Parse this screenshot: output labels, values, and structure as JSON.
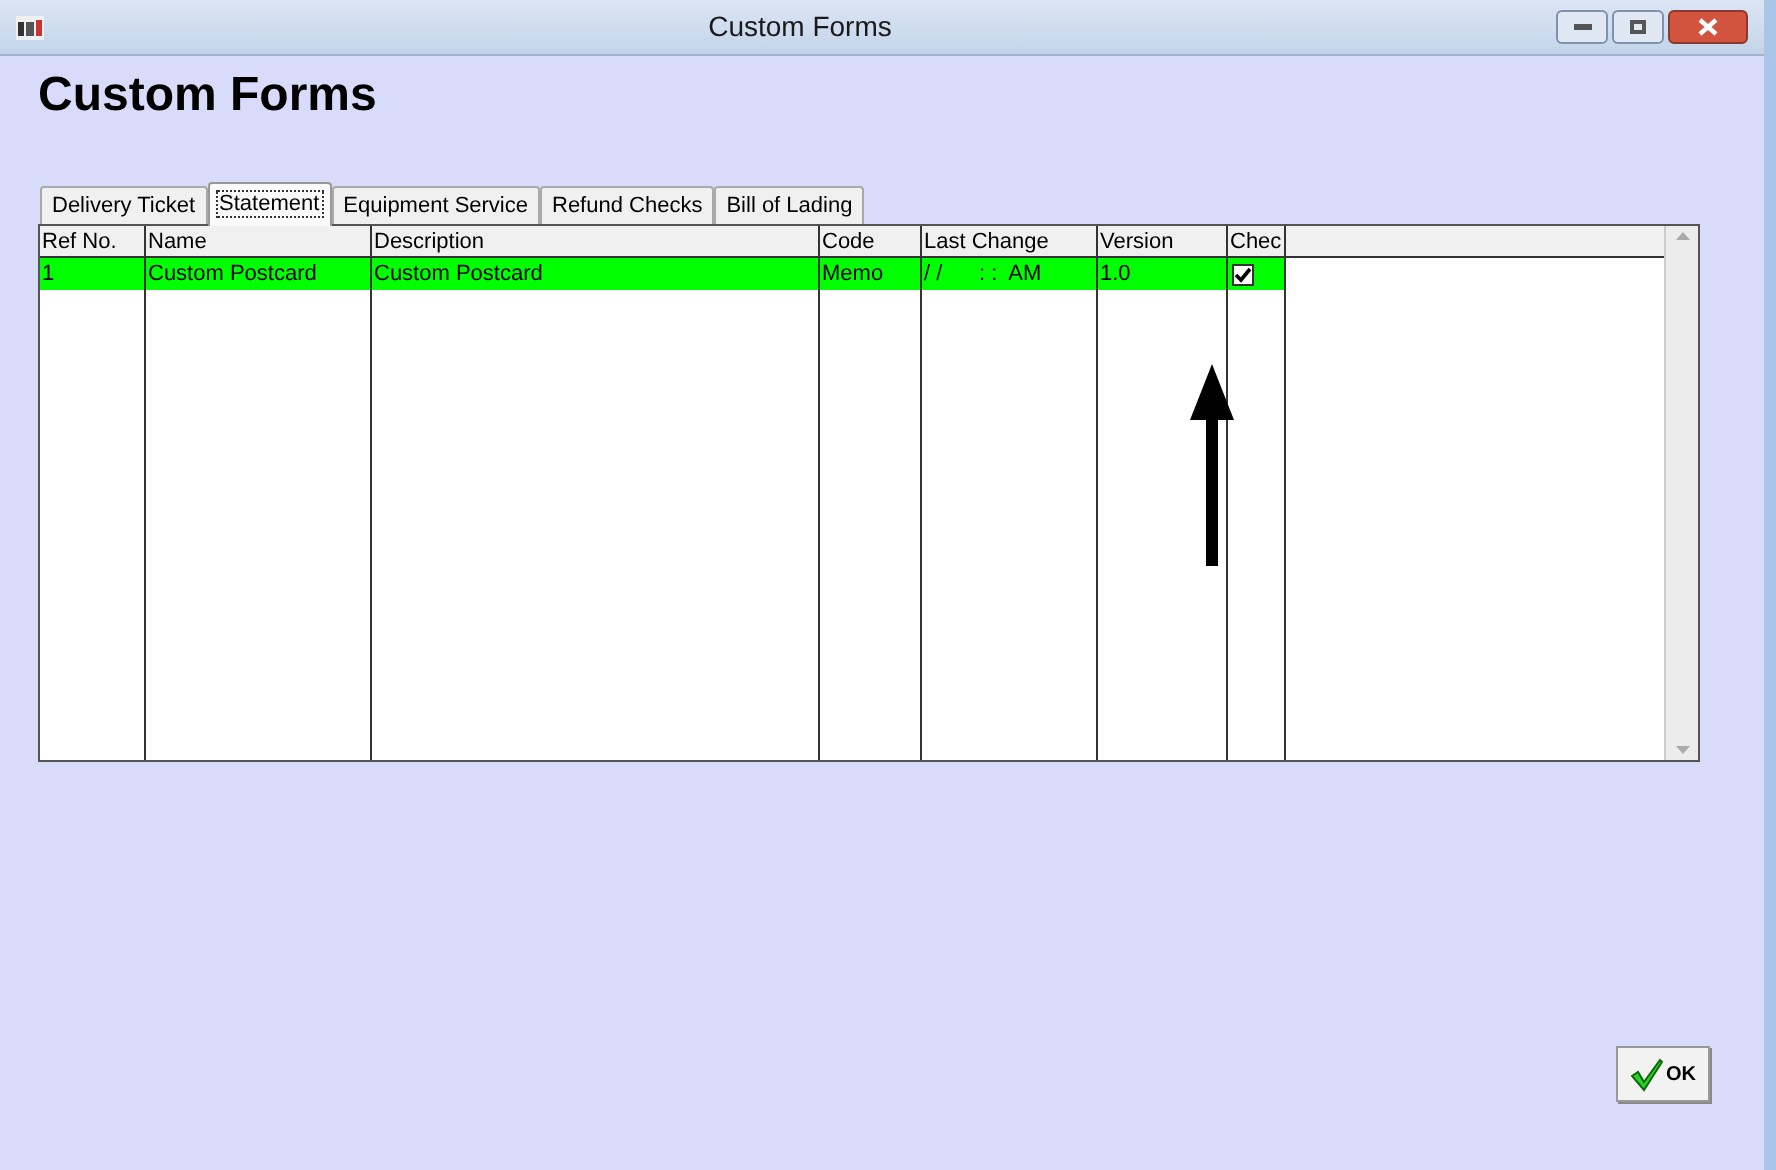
{
  "window": {
    "title": "Custom Forms"
  },
  "heading": "Custom Forms",
  "tabs": [
    {
      "label": "Delivery Ticket",
      "selected": false
    },
    {
      "label": "Statement",
      "selected": true
    },
    {
      "label": "Equipment Service",
      "selected": false
    },
    {
      "label": "Refund Checks",
      "selected": false
    },
    {
      "label": "Bill of Lading",
      "selected": false
    }
  ],
  "table": {
    "columns": [
      "Ref No.",
      "Name",
      "Description",
      "Code",
      "Last Change",
      "Version",
      "Chec"
    ],
    "rows": [
      {
        "cells": [
          "1",
          "Custom Postcard",
          "Custom Postcard",
          "Memo",
          "/ /      : :  AM",
          "1.0"
        ],
        "checked": true,
        "selected": true
      }
    ]
  },
  "ok_button": {
    "label": "OK"
  }
}
